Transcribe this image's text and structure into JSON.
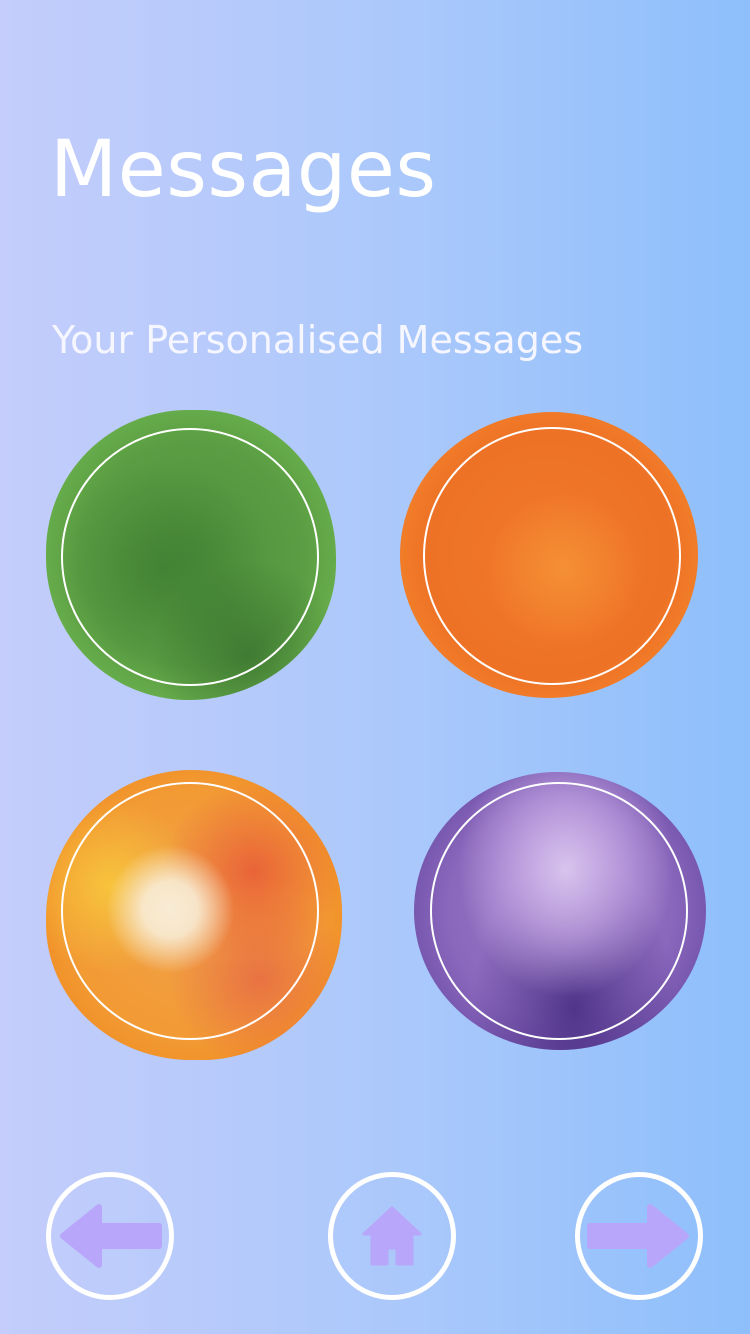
{
  "page": {
    "title": "Messages",
    "subtitle": "Your Personalised Messages"
  },
  "message_circles": [
    {
      "color": "green",
      "hex": "#5a9d43"
    },
    {
      "color": "orange",
      "hex": "#ee7226"
    },
    {
      "color": "sunset",
      "hex": "#f29a34"
    },
    {
      "color": "purple",
      "hex": "#8a68bc"
    }
  ],
  "navigation": {
    "back_icon": "arrow-left-icon",
    "home_icon": "home-icon",
    "next_icon": "arrow-right-icon",
    "icon_color": "#b8a6fa",
    "ring_color": "#ffffff"
  },
  "colors": {
    "background_left": "#c4cdfb",
    "background_right": "#8ebffb",
    "text": "#ffffff"
  }
}
